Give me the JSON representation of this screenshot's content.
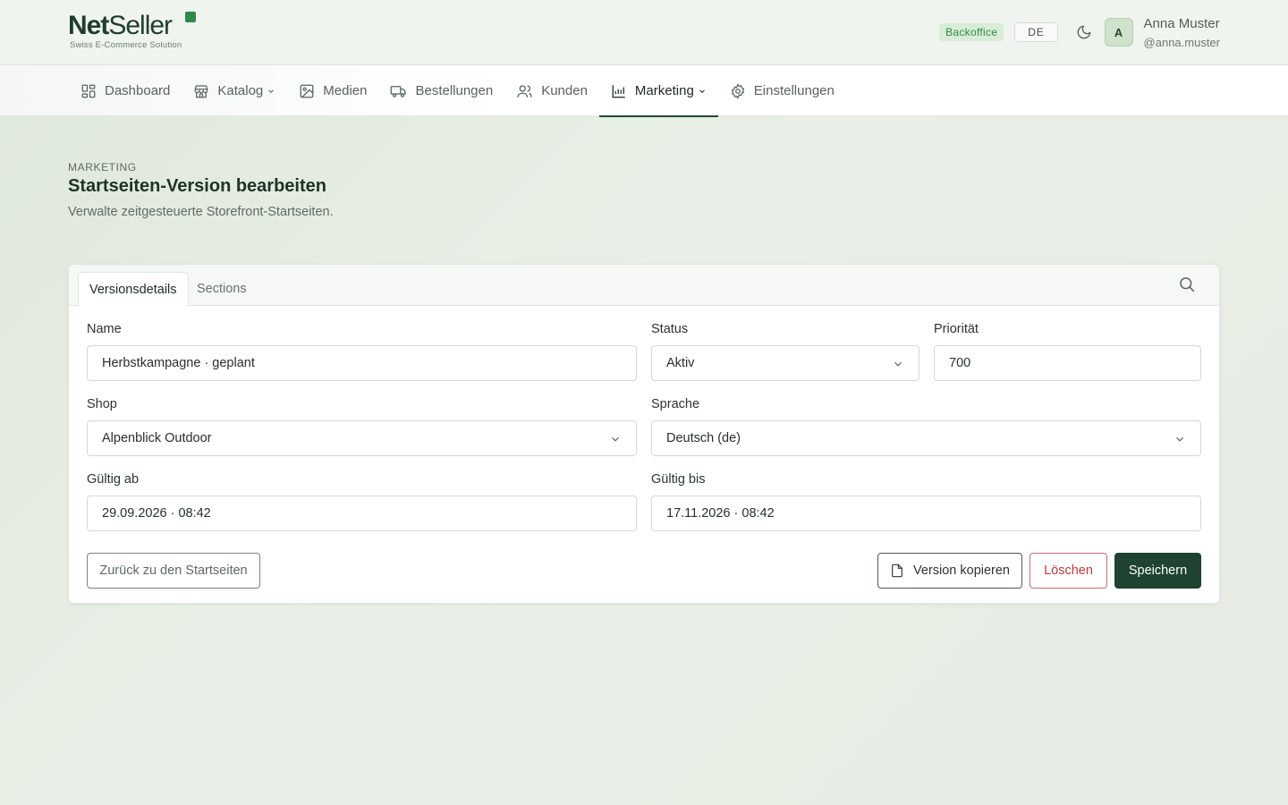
{
  "header": {
    "logo_net": "Net",
    "logo_seller": "Seller",
    "logo_tagline": "Swiss E-Commerce Solution",
    "env_badge": "Backoffice",
    "language": "DE",
    "user_initial": "A",
    "user_name": "Anna Muster",
    "user_handle": "@anna.muster"
  },
  "nav": {
    "items": [
      {
        "label": "Dashboard",
        "icon": "dashboard-icon"
      },
      {
        "label": "Katalog",
        "icon": "store-icon",
        "dropdown": true
      },
      {
        "label": "Medien",
        "icon": "image-icon"
      },
      {
        "label": "Bestellungen",
        "icon": "truck-icon"
      },
      {
        "label": "Kunden",
        "icon": "users-icon"
      },
      {
        "label": "Marketing",
        "icon": "chart-icon",
        "dropdown": true,
        "active": true
      },
      {
        "label": "Einstellungen",
        "icon": "gear-icon"
      }
    ]
  },
  "page": {
    "eyebrow": "MARKETING",
    "title": "Startseiten-Version bearbeiten",
    "subtitle": "Verwalte zeitgesteuerte Storefront-Startseiten."
  },
  "tabs": {
    "details": "Versionsdetails",
    "sections": "Sections"
  },
  "form": {
    "name_label": "Name",
    "name_value": "Herbstkampagne · geplant",
    "status_label": "Status",
    "status_value": "Aktiv",
    "priority_label": "Priorität",
    "priority_value": "700",
    "shop_label": "Shop",
    "shop_value": "Alpenblick Outdoor",
    "language_label": "Sprache",
    "language_value": "Deutsch (de)",
    "valid_from_label": "Gültig ab",
    "valid_from_value": "29.09.2026 · 08:42",
    "valid_to_label": "Gültig bis",
    "valid_to_value": "17.11.2026 · 08:42"
  },
  "actions": {
    "back": "Zurück zu den Startseiten",
    "copy": "Version kopieren",
    "delete": "Löschen",
    "save": "Speichern"
  },
  "colors": {
    "brand": "#1f4330",
    "accent_green": "#2f8a4a",
    "danger": "#c03b3b"
  }
}
